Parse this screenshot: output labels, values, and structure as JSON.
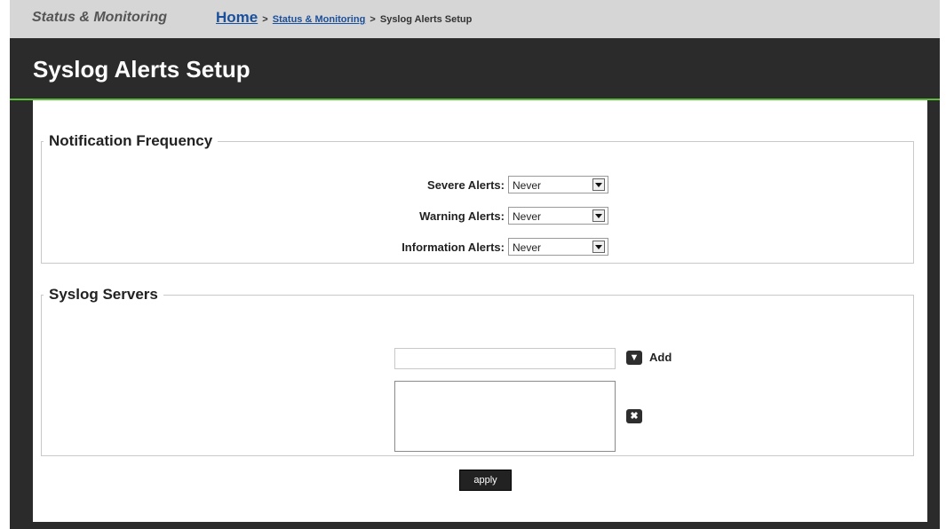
{
  "header": {
    "section_name": "Status & Monitoring",
    "breadcrumb": {
      "home": "Home",
      "separator": ">",
      "status_monitoring": "Status & Monitoring",
      "current": "Syslog Alerts Setup"
    }
  },
  "page": {
    "title": "Syslog Alerts Setup"
  },
  "notification_frequency": {
    "legend": "Notification Frequency",
    "rows": [
      {
        "label": "Severe Alerts:",
        "value": "Never"
      },
      {
        "label": "Warning Alerts:",
        "value": "Never"
      },
      {
        "label": "Information Alerts:",
        "value": "Never"
      }
    ]
  },
  "syslog_servers": {
    "legend": "Syslog Servers",
    "server_input_value": "",
    "add_label": "Add"
  },
  "actions": {
    "apply_label": "apply"
  },
  "colors": {
    "accent_green": "#5bbf3a",
    "dark_band": "#2b2b2b",
    "link_blue": "#1a4f9c"
  },
  "icons": {
    "add": "chevron-down-icon",
    "remove": "close-icon"
  }
}
